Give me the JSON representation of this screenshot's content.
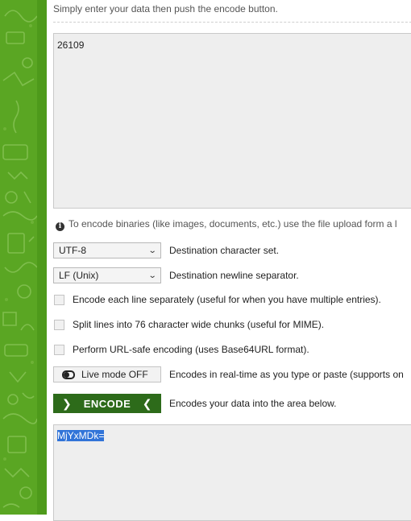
{
  "intro_text": "Simply enter your data then push the encode button.",
  "input": {
    "value": "26109"
  },
  "info": {
    "icon": "info-icon",
    "text": "To encode binaries (like images, documents, etc.) use the file upload form a l"
  },
  "charset": {
    "selected": "UTF-8",
    "label": "Destination character set."
  },
  "newline": {
    "selected": "LF (Unix)",
    "label": "Destination newline separator."
  },
  "options": {
    "each_line": "Encode each line separately (useful for when you have multiple entries).",
    "split_lines": "Split lines into 76 character wide chunks (useful for MIME).",
    "url_safe": "Perform URL-safe encoding (uses Base64URL format)."
  },
  "live_mode": {
    "label": "Live mode OFF",
    "description": "Encodes in real-time as you type or paste (supports on"
  },
  "encode": {
    "label": "ENCODE",
    "description": "Encodes your data into the area below."
  },
  "output": {
    "value": "MjYxMDk="
  },
  "colors": {
    "sidebar_green": "#5aa623",
    "encode_button": "#2d6b1a",
    "selection": "#3174d8"
  }
}
